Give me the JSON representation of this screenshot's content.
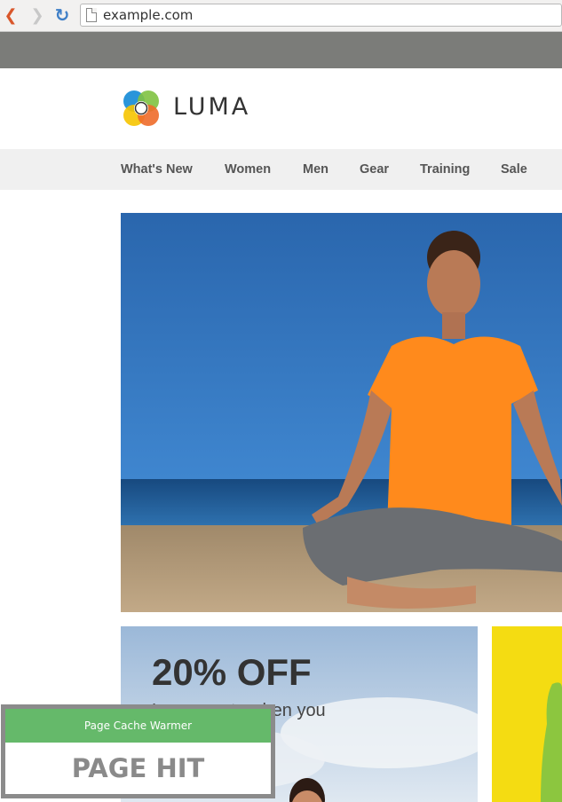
{
  "browser": {
    "url": "example.com",
    "back_icon": "back-arrow-icon",
    "forward_icon": "forward-arrow-icon",
    "reload_icon": "reload-icon"
  },
  "brand": {
    "name": "LUMA"
  },
  "nav": {
    "items": [
      {
        "label": "What's New"
      },
      {
        "label": "Women"
      },
      {
        "label": "Men"
      },
      {
        "label": "Gear"
      },
      {
        "label": "Training"
      },
      {
        "label": "Sale"
      }
    ]
  },
  "promo": {
    "title": "20% OFF",
    "subtitle": "Luma pants when you"
  },
  "widget": {
    "title": "Page Cache Warmer",
    "status": "PAGE HIT"
  },
  "colors": {
    "topbar": "#7b7c79",
    "navbar": "#f0f0f0",
    "widget_header": "#65b96a",
    "yellow_card": "#f4dc12",
    "sky": "#2f6fb6",
    "shirt": "#ff8a1c"
  }
}
